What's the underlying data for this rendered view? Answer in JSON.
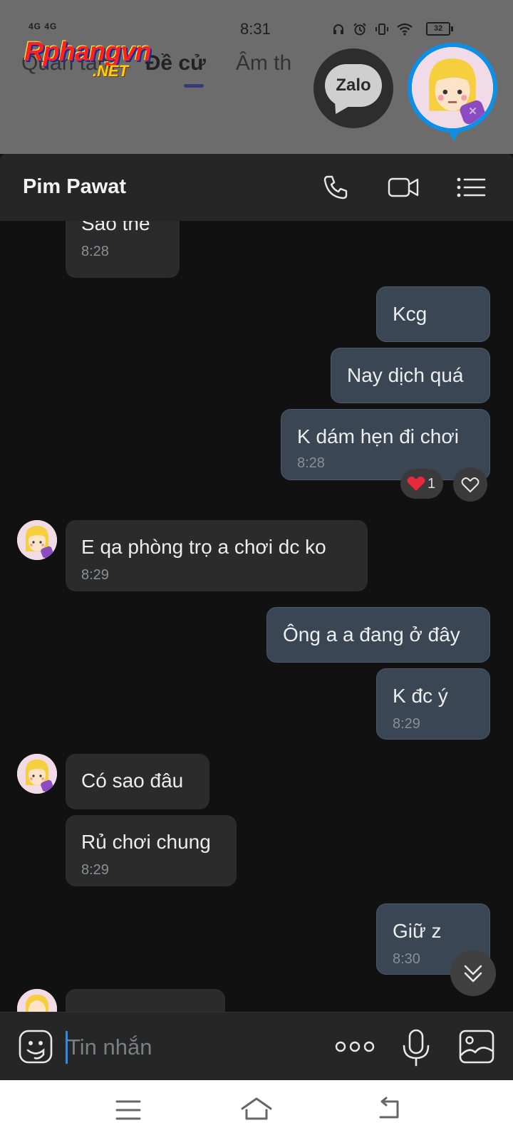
{
  "status_bar": {
    "signal": "4G 4G",
    "time": "8:31",
    "battery": "32"
  },
  "background": {
    "tabs": [
      "Quan tâm",
      "Đề cử",
      "Âm th"
    ],
    "zalo_label": "Zalo"
  },
  "watermark": {
    "main": "Rphangvn",
    "sub": ".NET"
  },
  "header": {
    "contact_name": "Pim Pawat"
  },
  "messages": [
    {
      "dir": "in",
      "text": "Sao thế",
      "time": "8:28"
    },
    {
      "dir": "out",
      "text": "Kcg",
      "time": ""
    },
    {
      "dir": "out",
      "text": "Nay dịch quá",
      "time": ""
    },
    {
      "dir": "out",
      "text": "K dám hẹn đi chơi",
      "time": "8:28",
      "reaction_count": "1"
    },
    {
      "dir": "in",
      "text": "E qa phòng trọ a chơi dc ko",
      "time": "8:29"
    },
    {
      "dir": "out",
      "text": "Ông a a đang ở đây",
      "time": ""
    },
    {
      "dir": "out",
      "text": "K đc ý",
      "time": "8:29"
    },
    {
      "dir": "in",
      "text": "Có sao đâu",
      "time": ""
    },
    {
      "dir": "in",
      "text": "Rủ chơi chung",
      "time": "8:29"
    },
    {
      "dir": "out",
      "text": "Giữ z",
      "time": "8:30"
    }
  ],
  "input": {
    "placeholder": "Tin nhắn"
  },
  "colors": {
    "background": "#111111",
    "incoming_bubble": "#2b2b2b",
    "outgoing_bubble": "#3a4654",
    "header": "#262626",
    "accent": "#2b8cf0",
    "heart": "#e8283c"
  }
}
